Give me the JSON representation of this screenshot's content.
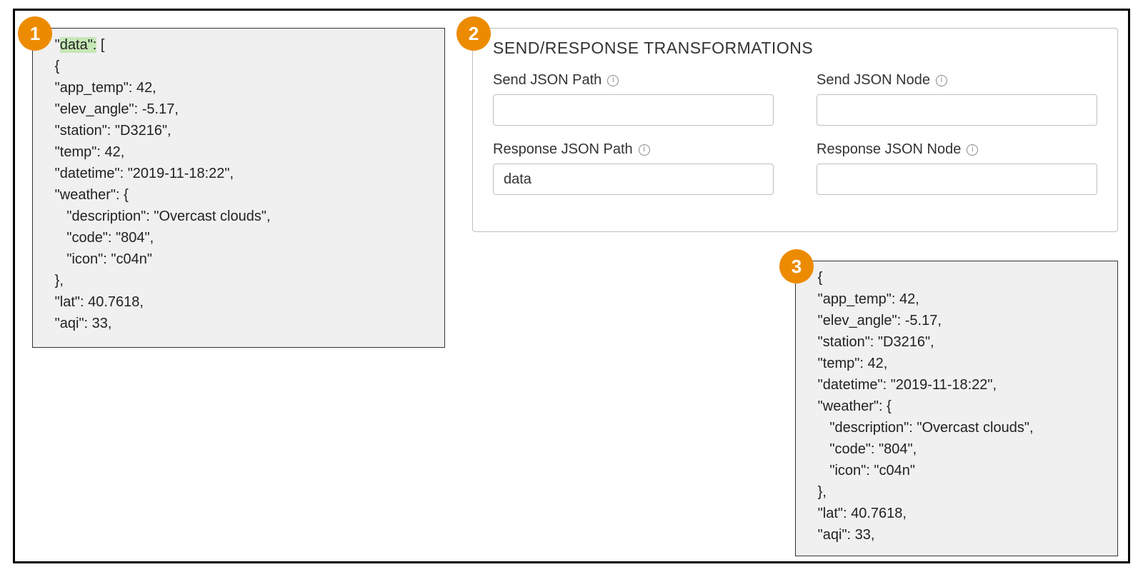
{
  "badges": {
    "one": "1",
    "two": "2",
    "three": "3"
  },
  "codebox1": {
    "highlight": "data\":",
    "rest_line1": " [",
    "lines": [
      "{",
      "\"app_temp\": 42,",
      "\"elev_angle\": -5.17,",
      "\"station\": \"D3216\",",
      "\"temp\": 42,",
      "\"datetime\": \"2019-11-18:22\",",
      "\"weather\": {",
      "   \"description\": \"Overcast clouds\",",
      "   \"code\": \"804\",",
      "   \"icon\": \"c04n\"",
      "},",
      "\"lat\": 40.7618,",
      "\"aqi\": 33,"
    ]
  },
  "form": {
    "title": "SEND/RESPONSE TRANSFORMATIONS",
    "send_path_label": "Send JSON Path",
    "send_node_label": "Send JSON Node",
    "resp_path_label": "Response JSON Path",
    "resp_node_label": "Response JSON Node",
    "send_path_value": "",
    "send_node_value": "",
    "resp_path_value": "data",
    "resp_node_value": ""
  },
  "codebox3": {
    "lines": [
      "{",
      "\"app_temp\": 42,",
      "\"elev_angle\": -5.17,",
      "\"station\": \"D3216\",",
      "\"temp\": 42,",
      "\"datetime\": \"2019-11-18:22\",",
      "\"weather\": {",
      "   \"description\": \"Overcast clouds\",",
      "   \"code\": \"804\",",
      "   \"icon\": \"c04n\"",
      "},",
      "\"lat\": 40.7618,",
      "\"aqi\": 33,"
    ]
  }
}
